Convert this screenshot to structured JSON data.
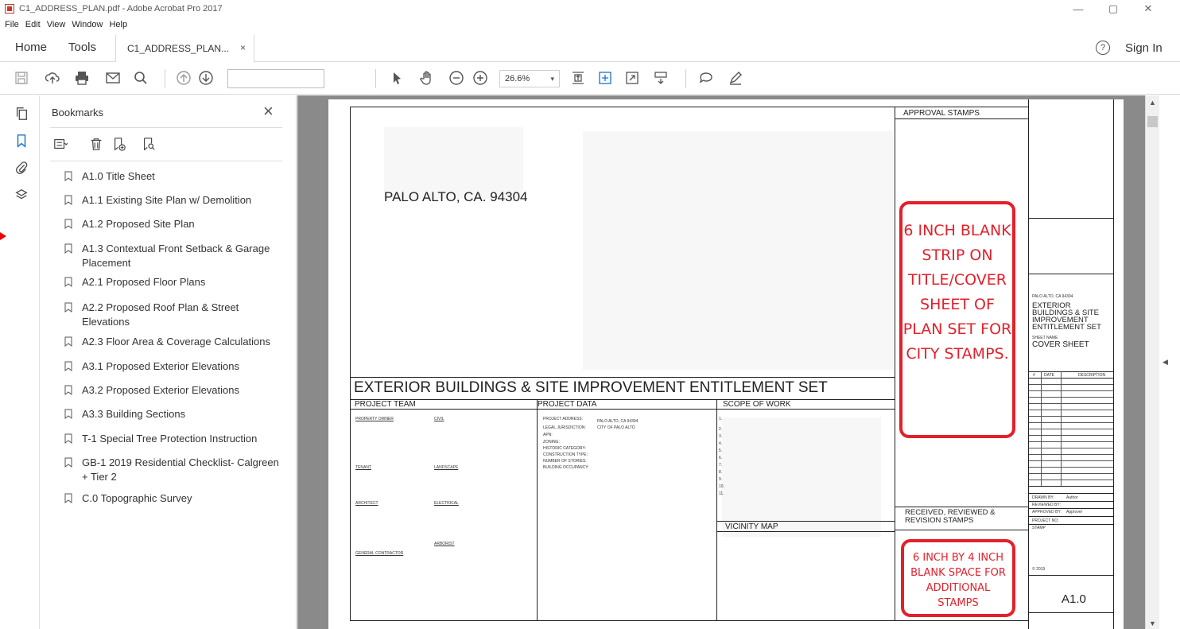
{
  "window": {
    "title": "C1_ADDRESS_PLAN.pdf - Adobe Acrobat Pro 2017",
    "minimize": "—",
    "maximize": "▢",
    "close": "✕"
  },
  "menu": [
    "File",
    "Edit",
    "View",
    "Window",
    "Help"
  ],
  "tabs": {
    "home": "Home",
    "tools": "Tools",
    "doc": "C1_ADDRESS_PLAN...",
    "doc_close": "×",
    "help": "?",
    "sign_in": "Sign In"
  },
  "toolbar": {
    "page_value": "",
    "zoom": "26.6%",
    "zoom_arrow": "▾"
  },
  "bookmarks": {
    "title": "Bookmarks",
    "close": "×",
    "items": [
      "A1.0 Title Sheet",
      "A1.1 Existing Site Plan w/ Demolition",
      "A1.2 Proposed Site Plan",
      "A1.3 Contextual Front Setback & Garage Placement",
      "A2.1 Proposed Floor Plans",
      "A2.2 Proposed Roof Plan & Street Elevations",
      "A2.3 Floor Area & Coverage Calculations",
      "A3.1 Proposed Exterior Elevations",
      "A3.2 Proposed Exterior Elevations",
      "A3.3 Building Sections",
      "T-1 Special Tree Protection Instruction",
      "GB-1 2019 Residential Checklist- Calgreen + Tier 2",
      "C.0 Topographic Survey"
    ]
  },
  "sheet": {
    "address": "PALO ALTO, CA. 94304",
    "set_title": "EXTERIOR BUILDINGS & SITE IMPROVEMENT ENTITLEMENT SET",
    "project_team": "PROJECT TEAM",
    "project_data": "PROJECT DATA",
    "scope_of_work": "SCOPE OF WORK",
    "vicinity_map": "VICINITY MAP",
    "approval_stamps": "APPROVAL STAMPS",
    "received_stamps": "RECEIVED, REVIEWED & REVISION STAMPS",
    "team_labels": [
      "PROPERTY OWNER",
      "CIVIL",
      "TENANT",
      "LANDSCAPE",
      "ARCHITECT",
      "ELECTRICAL",
      "ARBORIST",
      "GENERAL CONTRACTOR"
    ],
    "data_labels": [
      "PROJECT ADDRESS:",
      "LEGAL JURISDICTION:",
      "APN:",
      "ZONING:",
      "HISTORIC CATEGORY:",
      "CONSTRUCTION TYPE:",
      "NUMBER OF STORIES:",
      "BUILDING OCCUPANCY:"
    ],
    "data_values": [
      "PALO ALTO, CA 94304",
      "CITY OF PALO ALTO"
    ],
    "scope_numbers": [
      "1.",
      "2.",
      "3.",
      "4.",
      "5.",
      "6.",
      "7.",
      "8.",
      "9.",
      "10.",
      "11."
    ],
    "callout_strip": "6 INCH BLANK STRIP ON TITLE/COVER SHEET OF PLAN SET FOR CITY STAMPS.",
    "callout_space": "6 INCH BY 4 INCH BLANK SPACE FOR ADDITIONAL STAMPS",
    "tb_address": "PALO ALTO, CA 94304",
    "tb_project": "EXTERIOR BUILDINGS & SITE IMPROVEMENT ENTITLEMENT SET",
    "tb_sheet_name_label": "SHEET NAME",
    "tb_sheet_name": "COVER SHEET",
    "tb_rev_headers": [
      "#",
      "DATE",
      "DESCRIPTION"
    ],
    "tb_drawn": "DRAWN BY:",
    "tb_drawn_val": "Author",
    "tb_reviewed": "REVIEWED BY:",
    "tb_approved": "APPROVED BY:",
    "tb_approved_val": "Approver",
    "tb_project_no": "PROJECT NO:",
    "tb_stamp": "STAMP",
    "tb_copyright": "© 2019",
    "tb_sheet_no": "A1.0"
  },
  "colors": {
    "callout_red": "#e3202b",
    "doc_background": "#8a8a8a"
  }
}
